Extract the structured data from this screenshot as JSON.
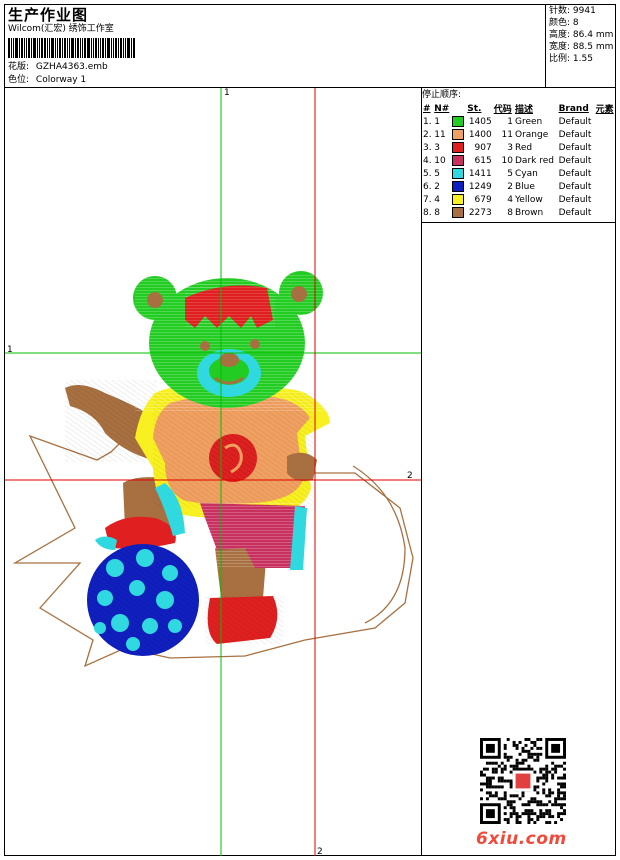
{
  "header": {
    "title": "生产作业图",
    "company": "Wilcom(汇宏) 绣饰工作室",
    "pattern_label": "花版:",
    "pattern_value": "GZHA4363.emb",
    "color_label": "色位:",
    "color_value": "Colorway 1"
  },
  "stats": {
    "stitches_label": "针数:",
    "stitches_value": "9941",
    "colors_label": "颜色:",
    "colors_value": "8",
    "height_label": "高度:",
    "height_value": "86.4 mm",
    "width_label": "宽度:",
    "width_value": "88.5 mm",
    "scale_label": "比例:",
    "scale_value": "1.55"
  },
  "thread_sequence": {
    "title": "停止顺序:",
    "columns": [
      "#",
      "N#",
      "St.",
      "代码",
      "描述",
      "Brand",
      "元素"
    ],
    "rows": [
      {
        "idx": "1.",
        "n": "1",
        "color": "#22cc22",
        "st": "1405",
        "code": "1",
        "desc": "Green",
        "brand": "Default"
      },
      {
        "idx": "2.",
        "n": "11",
        "color": "#f0a060",
        "st": "1400",
        "code": "11",
        "desc": "Orange",
        "brand": "Default"
      },
      {
        "idx": "3.",
        "n": "3",
        "color": "#e02020",
        "st": "907",
        "code": "3",
        "desc": "Red",
        "brand": "Default"
      },
      {
        "idx": "4.",
        "n": "10",
        "color": "#c83060",
        "st": "615",
        "code": "10",
        "desc": "Dark red",
        "brand": "Default"
      },
      {
        "idx": "5.",
        "n": "5",
        "color": "#30d8e0",
        "st": "1411",
        "code": "5",
        "desc": "Cyan",
        "brand": "Default"
      },
      {
        "idx": "6.",
        "n": "2",
        "color": "#1020c0",
        "st": "1249",
        "code": "2",
        "desc": "Blue",
        "brand": "Default"
      },
      {
        "idx": "7.",
        "n": "4",
        "color": "#f8f020",
        "st": "679",
        "code": "4",
        "desc": "Yellow",
        "brand": "Default"
      },
      {
        "idx": "8.",
        "n": "8",
        "color": "#a87040",
        "st": "2273",
        "code": "8",
        "desc": "Brown",
        "brand": "Default"
      }
    ]
  },
  "axes": {
    "top": "1",
    "left": "1",
    "right": "2",
    "bottom": "2"
  },
  "watermark": "6xiu.com"
}
